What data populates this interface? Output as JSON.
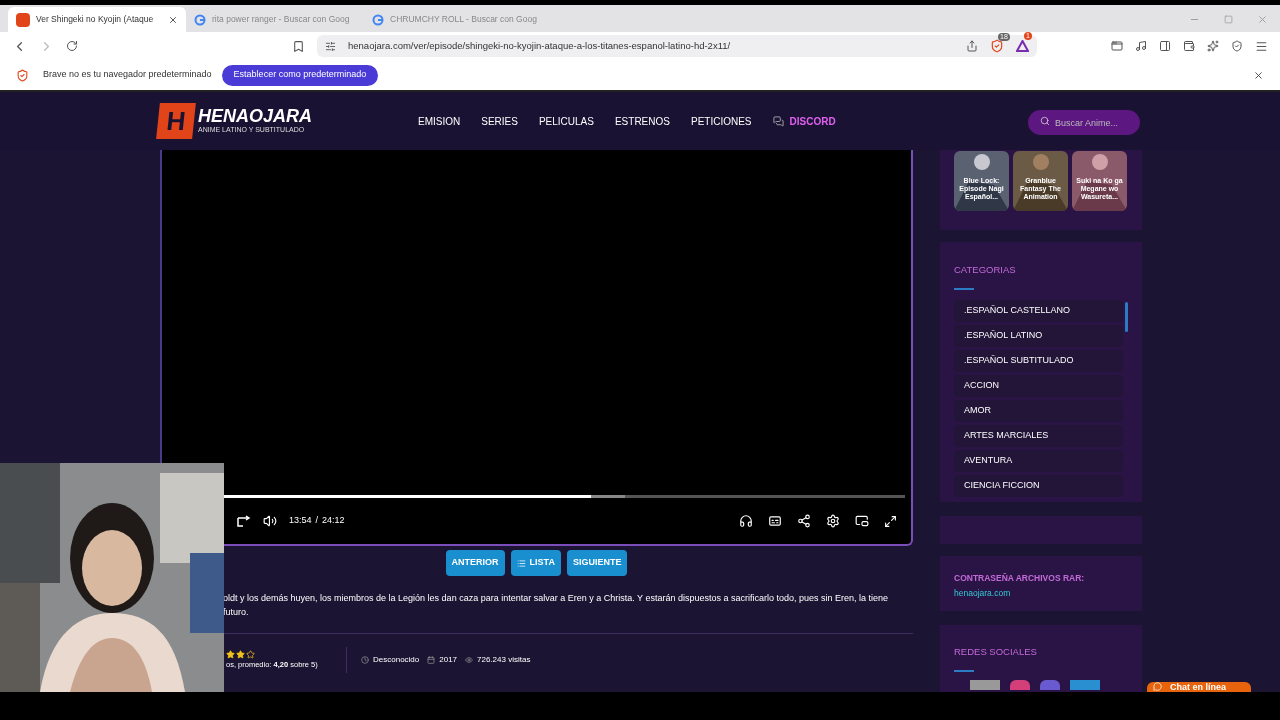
{
  "browser": {
    "tabs": [
      {
        "title": "Ver Shingeki no Kyojin (Ataque",
        "selected": true
      },
      {
        "title": "rita power ranger - Buscar con Goog",
        "selected": false
      },
      {
        "title": "CHRUMCHY ROLL - Buscar con Goog",
        "selected": false
      }
    ],
    "url": "henaojara.com/ver/episode/shingeki-no-kyojin-ataque-a-los-titanes-espanol-latino-hd-2x11/",
    "shield_count": "18",
    "rewards_count": "1",
    "infobar": {
      "message": "Brave no es tu navegador predeterminado",
      "button": "Establecer como predeterminado"
    }
  },
  "site": {
    "logo": {
      "initial": "H",
      "name": "HENAOJARA",
      "tagline": "ANIME LATINO Y SUBTITULADO"
    },
    "nav": [
      {
        "label": "EMISION",
        "kind": "link"
      },
      {
        "label": "SERIES",
        "kind": "link"
      },
      {
        "label": "PELICULAS",
        "kind": "link"
      },
      {
        "label": "ESTRENOS",
        "kind": "link"
      },
      {
        "label": "PETICIONES",
        "kind": "link"
      },
      {
        "label": "DISCORD",
        "kind": "discord"
      }
    ],
    "search": {
      "placeholder": "Buscar Anime..."
    }
  },
  "player": {
    "current": "13:54",
    "separator": "/",
    "duration": "24:12",
    "level": 0.54
  },
  "episode_nav": [
    {
      "label": "ANTERIOR",
      "kind": "plain"
    },
    {
      "label": "LISTA",
      "kind": "list"
    },
    {
      "label": "SIGUIENTE",
      "kind": "plain"
    }
  ],
  "description": "oldt y los demás huyen, los miembros de la Legión les dan caza para intentar salvar a Eren y a Christa. Y estarán dispuestos a sacrificarlo todo, pues sin Eren, la tiene futuro.",
  "rating": {
    "stars": 2,
    "text": "os, promedio: **4,20** sobre 5)"
  },
  "meta": [
    {
      "kind": "clock",
      "text": "Desconocido"
    },
    {
      "kind": "calendar",
      "text": "2017"
    },
    {
      "kind": "eye",
      "text": "726.243 visitas"
    }
  ],
  "sidebar": {
    "featured": [
      {
        "title": "Blue Lock: Episode Nagi Español..."
      },
      {
        "title": "Granblue Fantasy The Animation"
      },
      {
        "title": "Suki na Ko ga Megane wo Wasureta..."
      }
    ],
    "categories": {
      "title": "CATEGORIAS",
      "items": [
        ".ESPAÑOL CASTELLANO",
        ".ESPAÑOL LATINO",
        ".ESPAÑOL SUBTITULADO",
        "ACCION",
        "AMOR",
        "ARTES MARCIALES",
        "AVENTURA",
        "CIENCIA FICCION"
      ]
    },
    "password": {
      "title": "CONTRASEÑA ARCHIVOS RAR:",
      "value": "henaojara.com"
    },
    "social": {
      "title": "REDES SOCIALES"
    }
  },
  "chat": {
    "label": "Chat en línea"
  }
}
